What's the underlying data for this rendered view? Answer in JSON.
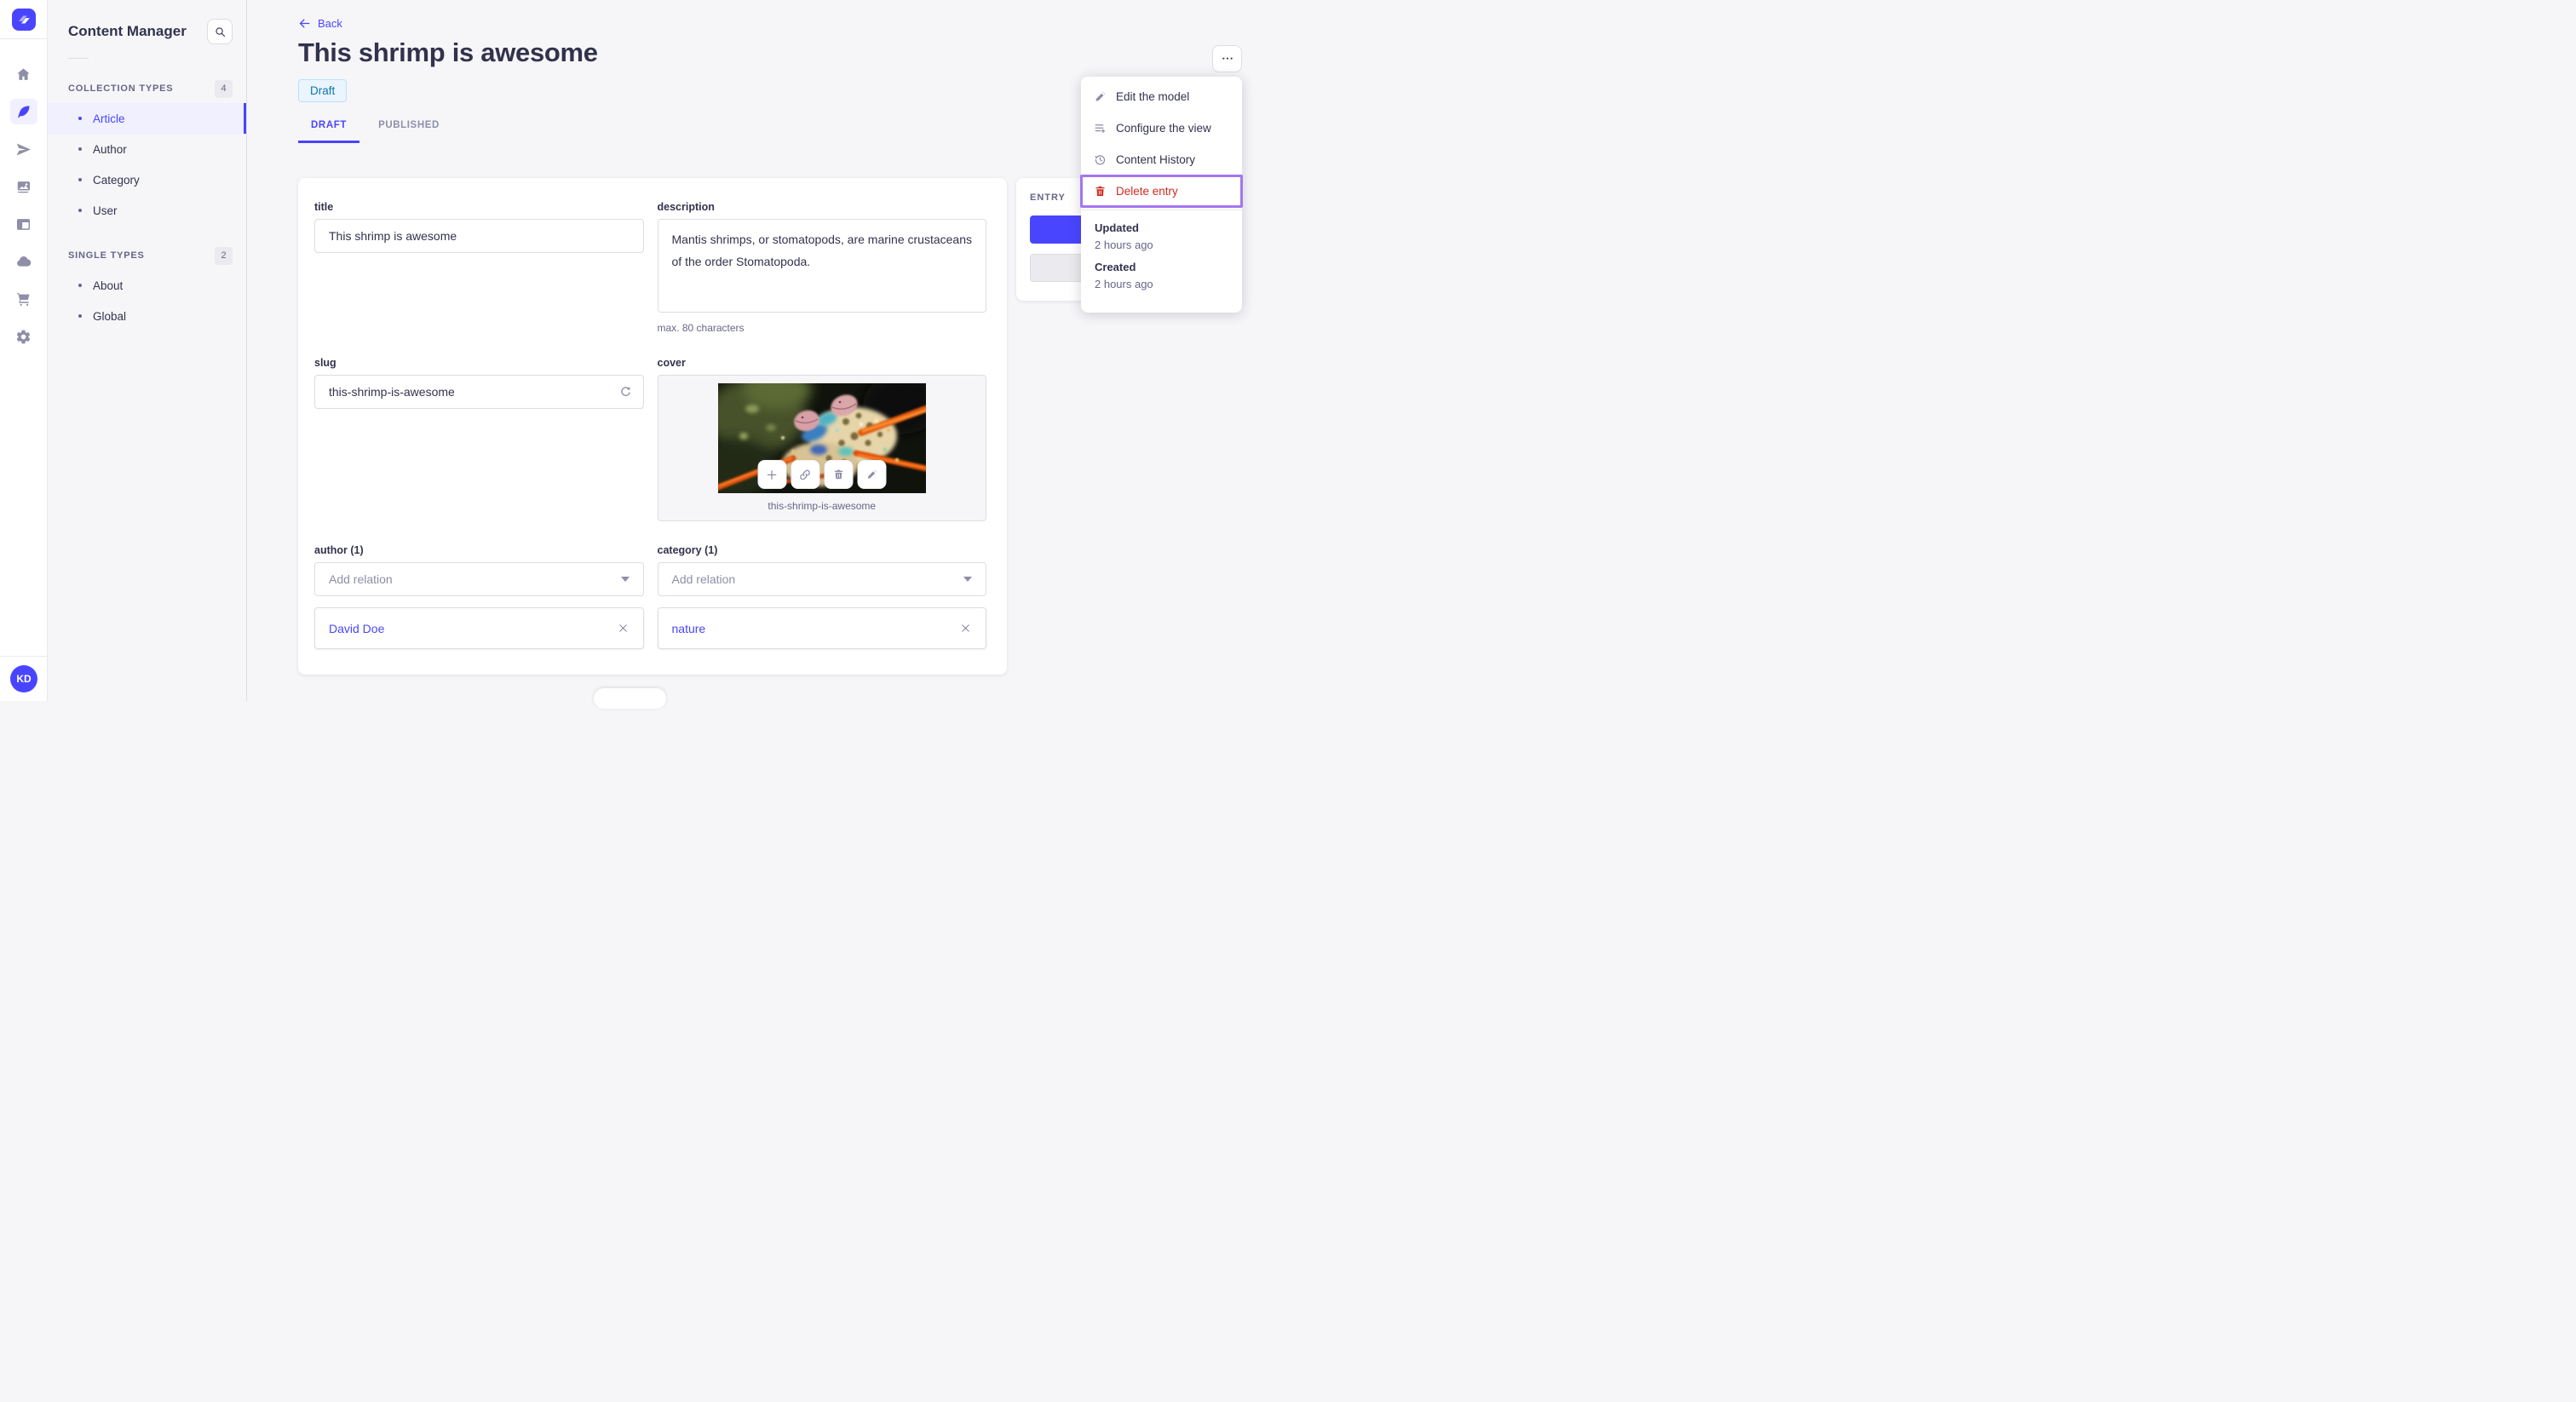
{
  "nav_rail": {
    "logo_icon": "strapi-logo",
    "icons": [
      {
        "name": "home-icon",
        "active": false
      },
      {
        "name": "feather-icon",
        "active": true
      },
      {
        "name": "paper-plane-icon",
        "active": false
      },
      {
        "name": "images-icon",
        "active": false
      },
      {
        "name": "layout-icon",
        "active": false
      },
      {
        "name": "cloud-icon",
        "active": false
      },
      {
        "name": "cart-icon",
        "active": false
      },
      {
        "name": "gear-icon",
        "active": false
      }
    ],
    "avatar_initials": "KD"
  },
  "subnav": {
    "title": "Content Manager",
    "search_icon": "search-icon",
    "sections": [
      {
        "label": "COLLECTION TYPES",
        "count": "4",
        "items": [
          {
            "label": "Article",
            "active": true
          },
          {
            "label": "Author",
            "active": false
          },
          {
            "label": "Category",
            "active": false
          },
          {
            "label": "User",
            "active": false
          }
        ]
      },
      {
        "label": "SINGLE TYPES",
        "count": "2",
        "items": [
          {
            "label": "About",
            "active": false
          },
          {
            "label": "Global",
            "active": false
          }
        ]
      }
    ]
  },
  "header": {
    "back_label": "Back",
    "back_arrow": "←",
    "title": "This shrimp is awesome",
    "status_badge": "Draft",
    "more_button": "...",
    "tabs": [
      {
        "label": "DRAFT",
        "active": true
      },
      {
        "label": "PUBLISHED",
        "active": false
      }
    ]
  },
  "context_menu": {
    "items": [
      {
        "label": "Edit the model",
        "icon": "pencil-icon",
        "danger": false
      },
      {
        "label": "Configure the view",
        "icon": "list-plus-icon",
        "danger": false
      },
      {
        "label": "Content History",
        "icon": "history-clock-icon",
        "danger": false
      },
      {
        "label": "Delete entry",
        "icon": "trash-icon",
        "danger": true,
        "highlighted": true
      }
    ],
    "meta": {
      "updated_label": "Updated",
      "updated_value": "2 hours ago",
      "created_label": "Created",
      "created_value": "2 hours ago"
    }
  },
  "entry_panel": {
    "label": "ENTRY"
  },
  "form": {
    "title": {
      "label": "title",
      "value": "This shrimp is awesome"
    },
    "description": {
      "label": "description",
      "value": "Mantis shrimps, or stomatopods, are marine crustaceans of the order Stomatopoda.",
      "helper": "max. 80 characters"
    },
    "slug": {
      "label": "slug",
      "value": "this-shrimp-is-awesome",
      "icon": "refresh-icon"
    },
    "cover": {
      "label": "cover",
      "caption": "this-shrimp-is-awesome",
      "action_icons": [
        "plus-icon",
        "link-icon",
        "trash-icon",
        "pencil-icon"
      ]
    },
    "author": {
      "label": "author (1)",
      "placeholder": "Add relation",
      "relation": "David Doe"
    },
    "category": {
      "label": "category (1)",
      "placeholder": "Add relation",
      "relation": "nature"
    }
  },
  "colors": {
    "accent": "#4945ff",
    "accent_light_bg": "#f0f0ff",
    "danger": "#d02b20",
    "highlight_outline": "#a376f2",
    "draft_badge_bg": "#eaf5ff",
    "draft_badge_border": "#b8e1ff",
    "draft_badge_text": "#0c75af",
    "text": "#32324d",
    "text_muted": "#666687",
    "border": "#dcdce4",
    "background": "#f6f6f9"
  }
}
